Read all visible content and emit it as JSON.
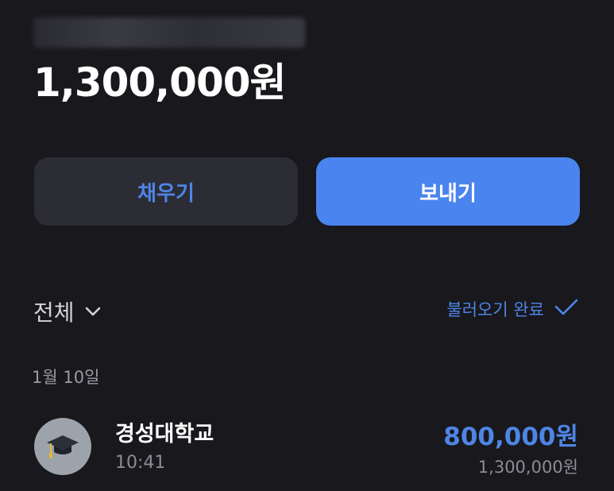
{
  "account": {
    "name_blurred": "",
    "balance": "1,300,000원"
  },
  "actions": {
    "charge_label": "채우기",
    "send_label": "보내기"
  },
  "filter": {
    "label": "전체",
    "icon": "chevron-down-icon"
  },
  "load_status": {
    "label": "불러오기 완료",
    "icon": "check-icon"
  },
  "transactions": {
    "groups": [
      {
        "date": "1월 10일",
        "items": [
          {
            "icon": "graduation-cap-icon",
            "name": "경성대학교",
            "time": "10:41",
            "amount": "800,000원",
            "balance_after": "1,300,000원"
          }
        ]
      }
    ]
  },
  "colors": {
    "background": "#18181d",
    "accent": "#4a84ee",
    "accent_text": "#4e85e5",
    "secondary_button": "#2c2c35"
  }
}
